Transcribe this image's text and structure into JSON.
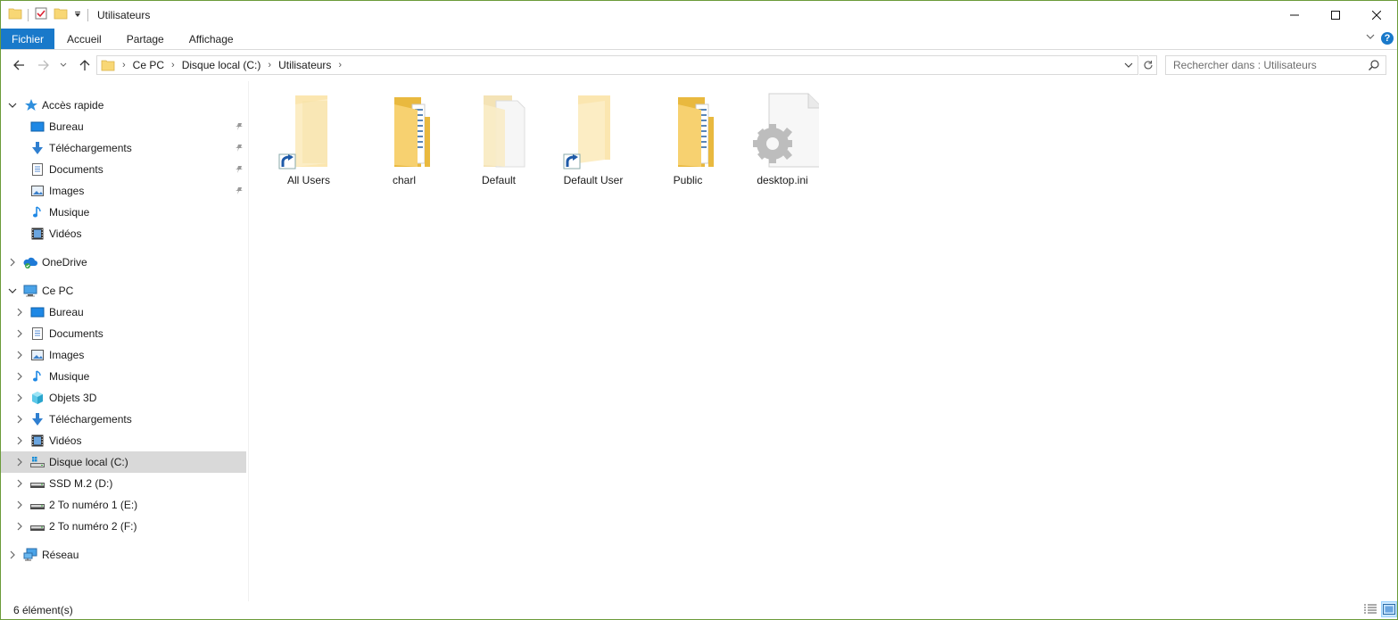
{
  "window": {
    "title": "Utilisateurs",
    "border_color": "#6b9b3a"
  },
  "ribbon": {
    "tabs": [
      {
        "label": "Fichier",
        "active": true
      },
      {
        "label": "Accueil"
      },
      {
        "label": "Partage"
      },
      {
        "label": "Affichage"
      }
    ],
    "accent": "#1979ca",
    "help_label": "?"
  },
  "address": {
    "breadcrumbs": [
      "Ce PC",
      "Disque local (C:)",
      "Utilisateurs"
    ]
  },
  "search": {
    "placeholder": "Rechercher dans : Utilisateurs"
  },
  "nav": {
    "quick_access": {
      "label": "Accès rapide",
      "items": [
        {
          "label": "Bureau",
          "icon": "desktop-icon",
          "pinned": true
        },
        {
          "label": "Téléchargements",
          "icon": "download-icon",
          "pinned": true
        },
        {
          "label": "Documents",
          "icon": "documents-icon",
          "pinned": true
        },
        {
          "label": "Images",
          "icon": "pictures-icon",
          "pinned": true
        },
        {
          "label": "Musique",
          "icon": "music-icon",
          "pinned": false
        },
        {
          "label": "Vidéos",
          "icon": "videos-icon",
          "pinned": false
        }
      ]
    },
    "onedrive": {
      "label": "OneDrive",
      "icon": "onedrive-icon"
    },
    "this_pc": {
      "label": "Ce PC",
      "items": [
        {
          "label": "Bureau",
          "icon": "desktop-icon"
        },
        {
          "label": "Documents",
          "icon": "documents-icon"
        },
        {
          "label": "Images",
          "icon": "pictures-icon"
        },
        {
          "label": "Musique",
          "icon": "music-icon"
        },
        {
          "label": "Objets 3D",
          "icon": "3d-objects-icon"
        },
        {
          "label": "Téléchargements",
          "icon": "download-icon"
        },
        {
          "label": "Vidéos",
          "icon": "videos-icon"
        },
        {
          "label": "Disque local (C:)",
          "icon": "windows-drive-icon",
          "selected": true
        },
        {
          "label": "SSD M.2 (D:)",
          "icon": "drive-icon"
        },
        {
          "label": "2 To numéro 1 (E:)",
          "icon": "drive-icon"
        },
        {
          "label": "2 To numéro 2 (F:)",
          "icon": "drive-icon"
        }
      ]
    },
    "network": {
      "label": "Réseau",
      "icon": "network-icon"
    }
  },
  "files": [
    {
      "name": "All Users",
      "type": "folder-shortcut"
    },
    {
      "name": "charl",
      "type": "folder"
    },
    {
      "name": "Default",
      "type": "folder-empty"
    },
    {
      "name": "Default User",
      "type": "folder-shortcut"
    },
    {
      "name": "Public",
      "type": "folder"
    },
    {
      "name": "desktop.ini",
      "type": "settings-file"
    }
  ],
  "status": {
    "item_count": "6 élément(s)"
  }
}
